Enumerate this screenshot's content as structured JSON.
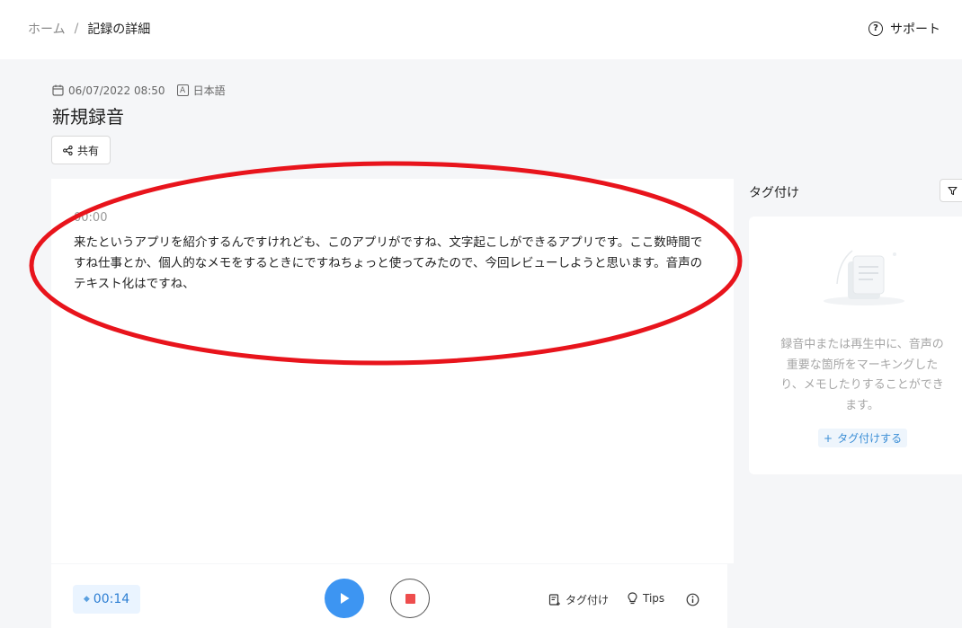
{
  "breadcrumb": {
    "home": "ホーム",
    "separator": "/",
    "current": "記録の詳細"
  },
  "support": {
    "label": "サポート",
    "icon": "help-circle-icon"
  },
  "recording": {
    "datetime": "06/07/2022 08:50",
    "language_icon_letter": "A",
    "language": "日本語",
    "title": "新規録音",
    "share_label": "共有"
  },
  "transcript": {
    "timestamp": "00:00",
    "text": "来たというアプリを紹介するんですけれども、このアプリがですね、文字起こしができるアプリです。ここ数時間ですね仕事とか、個人的なメモをするときにですねちょっと使ってみたので、今回レビューしようと思います。音声のテキスト化はですね、"
  },
  "tags": {
    "heading": "タグ付け",
    "empty_message": "録音中または再生中に、音声の重要な箇所をマーキングしたり、メモしたりすることができます。",
    "add_icon": "+",
    "add_label": "タグ付けする"
  },
  "player": {
    "current_time": "00:14",
    "tag_label": "タグ付け",
    "tips_label": "Tips"
  },
  "colors": {
    "accent": "#3d95f2",
    "stop": "#ee4d4d",
    "annotation": "#e8141c"
  }
}
